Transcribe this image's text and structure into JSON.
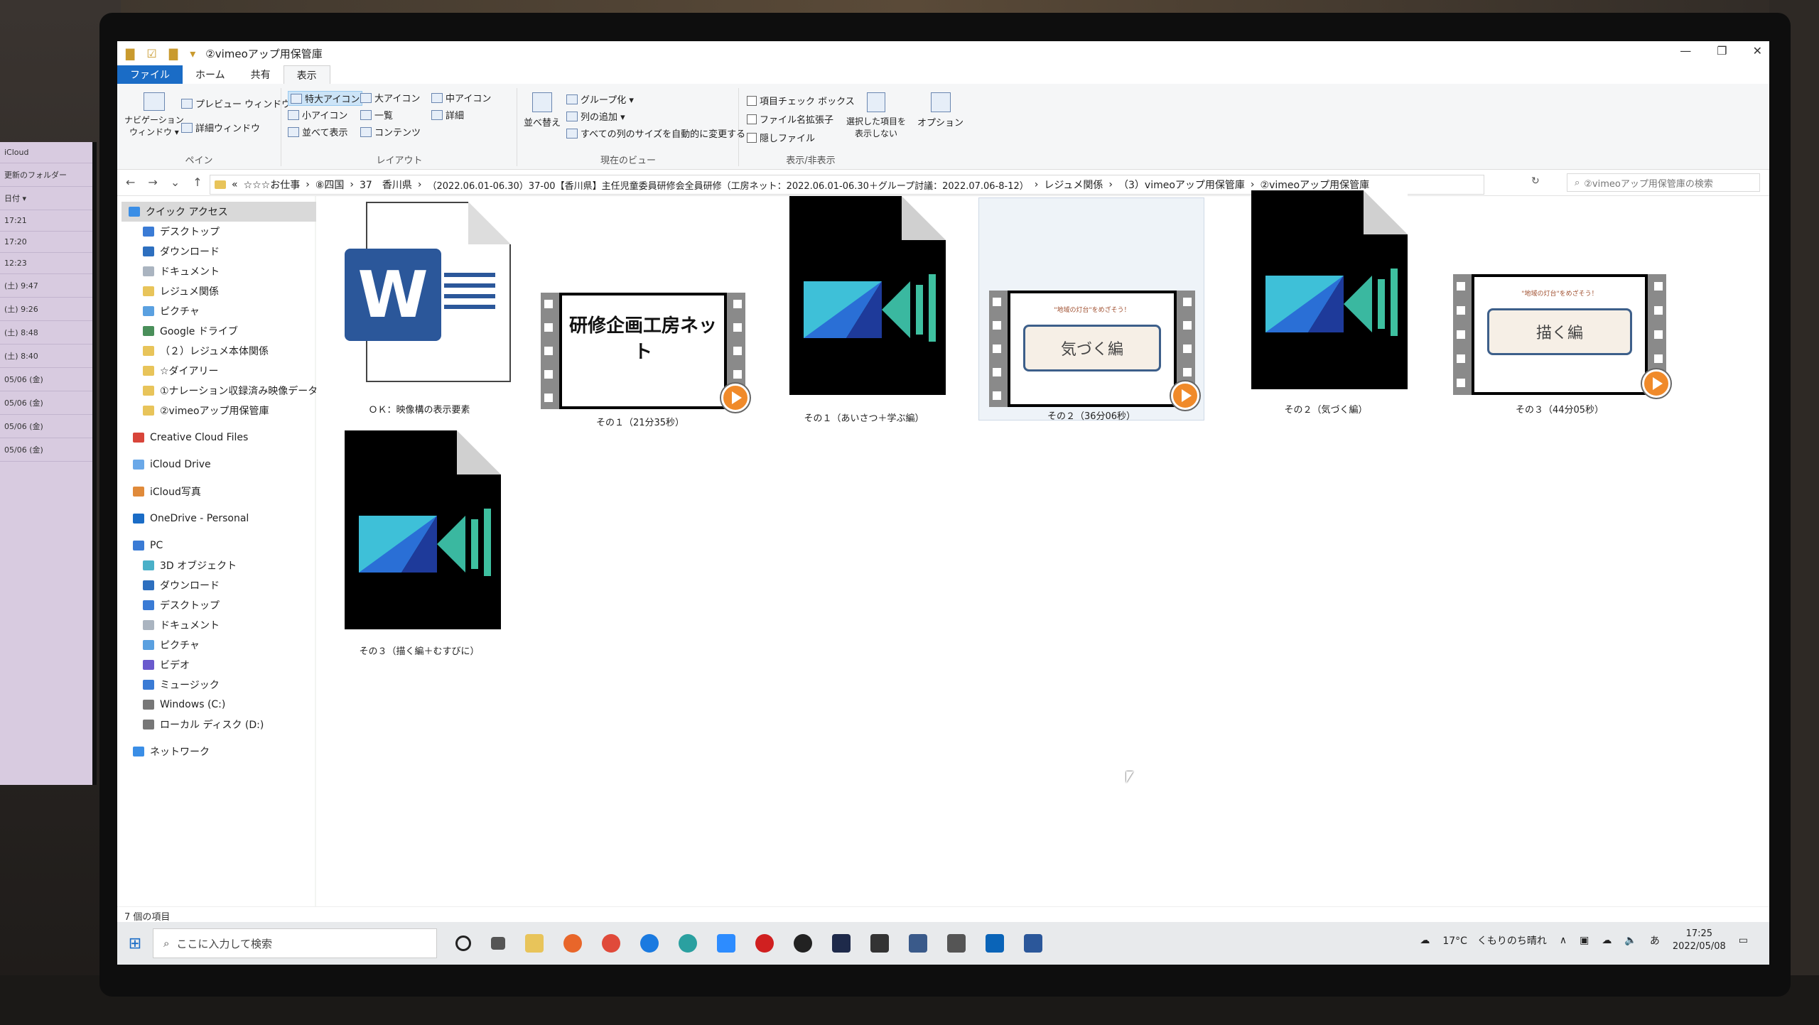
{
  "window": {
    "title": "②vimeoアップ用保管庫",
    "controls": [
      "—",
      "❐",
      "✕"
    ]
  },
  "ribbon_tabs": [
    "ファイル",
    "ホーム",
    "共有",
    "表示"
  ],
  "ribbon": {
    "pane": {
      "label": "ペイン",
      "nav_pane": "ナビゲーション\nウィンドウ ▾",
      "preview": "プレビュー ウィンドウ",
      "details": "詳細ウィンドウ"
    },
    "layout": {
      "label": "レイアウト",
      "xl_icons": "特大アイコン",
      "large_icons": "大アイコン",
      "medium_icons": "中アイコン",
      "small_icons": "小アイコン",
      "list": "一覧",
      "details": "詳細",
      "tiles": "並べて表示",
      "content": "コンテンツ"
    },
    "current_view": {
      "label": "現在のビュー",
      "sort": "並べ替え",
      "group": "グループ化 ▾",
      "add_columns": "列の追加 ▾",
      "fit_columns": "すべての列のサイズを自動的に変更する"
    },
    "show_hide": {
      "label": "表示/非表示",
      "item_checkbox": "項目チェック ボックス",
      "file_ext": "ファイル名拡張子",
      "hidden": "隠しファイル",
      "hide_selected": "選択した項目を\n表示しない",
      "options": "オプション"
    }
  },
  "address": {
    "segments": [
      "«",
      "☆☆☆お仕事",
      "›",
      "⑧四国",
      "›",
      "37　香川県",
      "›",
      "（2022.06.01-06.30）37-00【香川県】主任児童委員研修会全員研修（工房ネット：2022.06.01-06.30＋グループ討議：2022.07.06-8-12）",
      "›",
      "レジュメ関係",
      "›",
      "（3）vimeoアップ用保管庫",
      "›",
      "②vimeoアップ用保管庫"
    ],
    "search_placeholder": "②vimeoアップ用保管庫の検索"
  },
  "sidebar": {
    "quick_access": "クイック アクセス",
    "items": [
      "デスクトップ",
      "ダウンロード",
      "ドキュメント",
      "レジュメ関係",
      "ピクチャ",
      "Google ドライブ",
      "（２）レジュメ本体関係",
      "☆ダイアリー",
      "①ナレーション収録済み映像データ",
      "②vimeoアップ用保管庫"
    ],
    "cloud": [
      "Creative Cloud Files",
      "iCloud Drive",
      "iCloud写真",
      "OneDrive - Personal"
    ],
    "pc": "PC",
    "pc_items": [
      "3D オブジェクト",
      "ダウンロード",
      "デスクトップ",
      "ドキュメント",
      "ピクチャ",
      "ビデオ",
      "ミュージック",
      "Windows (C:)",
      "ローカル ディスク (D:)"
    ],
    "network": "ネットワーク"
  },
  "files": [
    {
      "name": "ＯＫ：映像構の表示要素",
      "type": "word"
    },
    {
      "name": "その１（21分35秒）",
      "type": "video",
      "frame_title": "研修企画工房ネット"
    },
    {
      "name": "その１（あいさつ＋学ぶ編）",
      "type": "powerdirector"
    },
    {
      "name": "その２（36分06秒）",
      "type": "video",
      "frame_small": "\"地域の灯台\"をめざそう！",
      "frame_pill": "気づく編"
    },
    {
      "name": "その２（気づく編）",
      "type": "powerdirector"
    },
    {
      "name": "その３（44分05秒）",
      "type": "video",
      "frame_small": "\"地域の灯台\"をめざそう！",
      "frame_pill": "描く編"
    },
    {
      "name": "その３（描く編＋むすびに）",
      "type": "powerdirector"
    }
  ],
  "status": {
    "count": "7 個の項目"
  },
  "taskbar": {
    "search_placeholder": "ここに入力して検索",
    "weather": "17°C　くもりのち晴れ",
    "ime": "あ",
    "time": "17:25",
    "date": "2022/05/08"
  },
  "laptop": {
    "rows": [
      "iCloud",
      "更新のフォルダー",
      "日付 ▾",
      "17:21",
      "17:20",
      "12:23",
      "(土) 9:47",
      "(土) 9:26",
      "(土) 8:48",
      "(土) 8:40",
      "05/06 (金)",
      "05/06 (金)",
      "05/06 (金)",
      "05/06 (金)"
    ]
  },
  "colors": {
    "accent": "#1a6cc6",
    "word": "#2b579a",
    "folder": "#e8c45a",
    "play": "#f08a2a"
  }
}
